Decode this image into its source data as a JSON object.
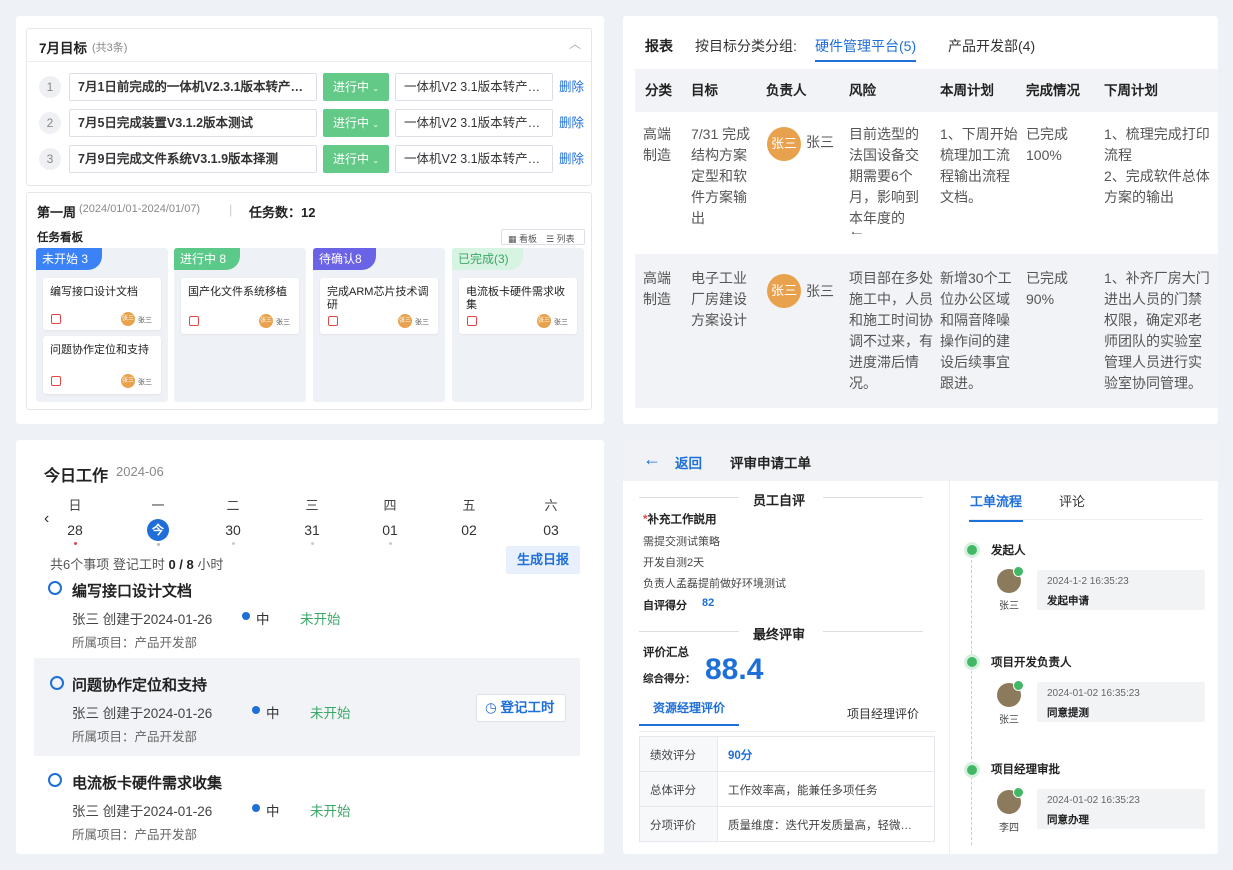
{
  "goals": {
    "title": "7月目标",
    "count": "(共3条)",
    "rows": [
      {
        "num": "1",
        "name": "7月1日前完成的一体机V2.3.1版本转产…",
        "status": "进行中",
        "version": "一体机V2 3.1版本转产…",
        "del": "删除"
      },
      {
        "num": "2",
        "name": "7月5日完成装置V3.1.2版本测试",
        "status": "进行中",
        "version": "一体机V2 3.1版本转产…",
        "del": "删除"
      },
      {
        "num": "3",
        "name": "7月9日完成文件系统V3.1.9版本择测",
        "status": "进行中",
        "version": "一体机V2 3.1版本转产…",
        "del": "删除"
      }
    ]
  },
  "week": {
    "title": "第一周",
    "range": "(2024/01/01-2024/01/07)",
    "task_count_label": "任务数：",
    "task_count": "12",
    "board_title": "任务看板",
    "view_board": "看板",
    "view_list": "列表"
  },
  "kanban": [
    {
      "label": "未开始 3",
      "color": "#3b82f6",
      "tasks": [
        {
          "title": "编写接口设计文档",
          "avatar": "张三",
          "owner": "张三"
        },
        {
          "title": "问题协作定位和支持",
          "avatar": "张三",
          "owner": "张三"
        }
      ]
    },
    {
      "label": "进行中 8",
      "color": "#5bc98a",
      "tasks": [
        {
          "title": "国产化文件系统移植",
          "avatar": "张三",
          "owner": "张三"
        }
      ]
    },
    {
      "label": "待确认8",
      "color": "#6b63e6",
      "tasks": [
        {
          "title": "完成ARM芯片技术调研",
          "avatar": "张三",
          "owner": "张三"
        }
      ]
    },
    {
      "label": "已完成(3)",
      "color": "#5bc98a",
      "tasks": [
        {
          "title": "电流板卡硬件需求收集",
          "avatar": "张三",
          "owner": "张三"
        }
      ]
    }
  ],
  "report": {
    "title": "报表",
    "group_label": "按目标分类分组:",
    "tab_active": "硬件管理平台(5)",
    "tab_other": "产品开发部(4)",
    "headers": [
      "分类",
      "目标",
      "负责人",
      "风险",
      "本周计划",
      "完成情况",
      "下周计划"
    ],
    "rows": [
      {
        "category": "高端制造",
        "goal": "7/31 完成结构方案定型和软件方案输出",
        "avatar": "张三",
        "owner": "张三",
        "risk": "目前选型的法国设备交期需要6个月，影响到本年度的年……",
        "plan": "1、下周开始梳理加工流程输出流程文档。",
        "done": "已完成100%",
        "next": "1、梳理完成打印流程\n2、完成软件总体方案的输出"
      },
      {
        "category": "高端制造",
        "goal": "电子工业厂房建设方案设计",
        "avatar": "张三",
        "owner": "张三",
        "risk": "项目部在多处施工中，人员和施工时间协调不过来，有进度滞后情况。",
        "plan": "新增30个工位办公区域和隔音降噪操作间的建设后续事宜跟进。",
        "done": "已完成90%",
        "next": "1、补齐厂房大门进出人员的门禁权限，确定邓老师团队的实验室管理人员进行实验室协同管理。"
      }
    ]
  },
  "today": {
    "title": "今日工作",
    "date": "2024-06",
    "days": [
      {
        "w": "日",
        "n": "28"
      },
      {
        "w": "一",
        "n": "今"
      },
      {
        "w": "二",
        "n": "30"
      },
      {
        "w": "三",
        "n": "31"
      },
      {
        "w": "四",
        "n": "01"
      },
      {
        "w": "五",
        "n": "02"
      },
      {
        "w": "六",
        "n": "03"
      }
    ],
    "summary_a": "共6个事项  登记工时",
    "hours": "0 / 8",
    "summary_b": "小时",
    "gen_report": "生成日报",
    "log_hours": "登记工时",
    "tasks": [
      {
        "title": "编写接口设计文档",
        "meta": "张三  创建于2024-01-26",
        "priority": "中",
        "status": "未开始",
        "project": "所属项目：产品开发部"
      },
      {
        "title": "问题协作定位和支持",
        "meta": "张三   创建于2024-01-26",
        "priority": "中",
        "status": "未开始",
        "project": "所属项目：产品开发部"
      },
      {
        "title": "电流板卡硬件需求收集",
        "meta": "张三   创建于2024-01-26",
        "priority": "中",
        "status": "未开始",
        "project": "所属项目：产品开发部"
      }
    ]
  },
  "review": {
    "back": "返回",
    "title": "评审申请工单",
    "self_title": "员工自评",
    "supplement_label": "补充工作説用",
    "lines": [
      "需提交测试策略",
      "开发自测2天",
      "负责人孟磊提前做好环境测试"
    ],
    "self_score_label": "自评得分",
    "self_score": "82",
    "final_title": "最终评审",
    "summary_label": "评价汇总",
    "total_label": "综合得分：",
    "total": "88.4",
    "tab_resource": "资源经理评价",
    "tab_project": "项目经理评价",
    "table": [
      {
        "k": "绩效评分",
        "v": "90分"
      },
      {
        "k": "总体评分",
        "v": "工作效率高，能兼任多项任务"
      },
      {
        "k": "分项评价",
        "v": "质量维度：迭代开发质量高，轻微…"
      }
    ],
    "tab_flow": "工单流程",
    "tab_comment": "评论",
    "flow": [
      {
        "step": "发起人",
        "person": "张三",
        "time": "2024-1-2 16:35:23",
        "action": "发起申请"
      },
      {
        "step": "项目开发负责人",
        "person": "张三",
        "time": "2024-01-02 16:35:23",
        "action": "同意提测"
      },
      {
        "step": "项目经理审批",
        "person": "李四",
        "time": "2024-01-02 16:35:23",
        "action": "同意办理"
      }
    ]
  }
}
